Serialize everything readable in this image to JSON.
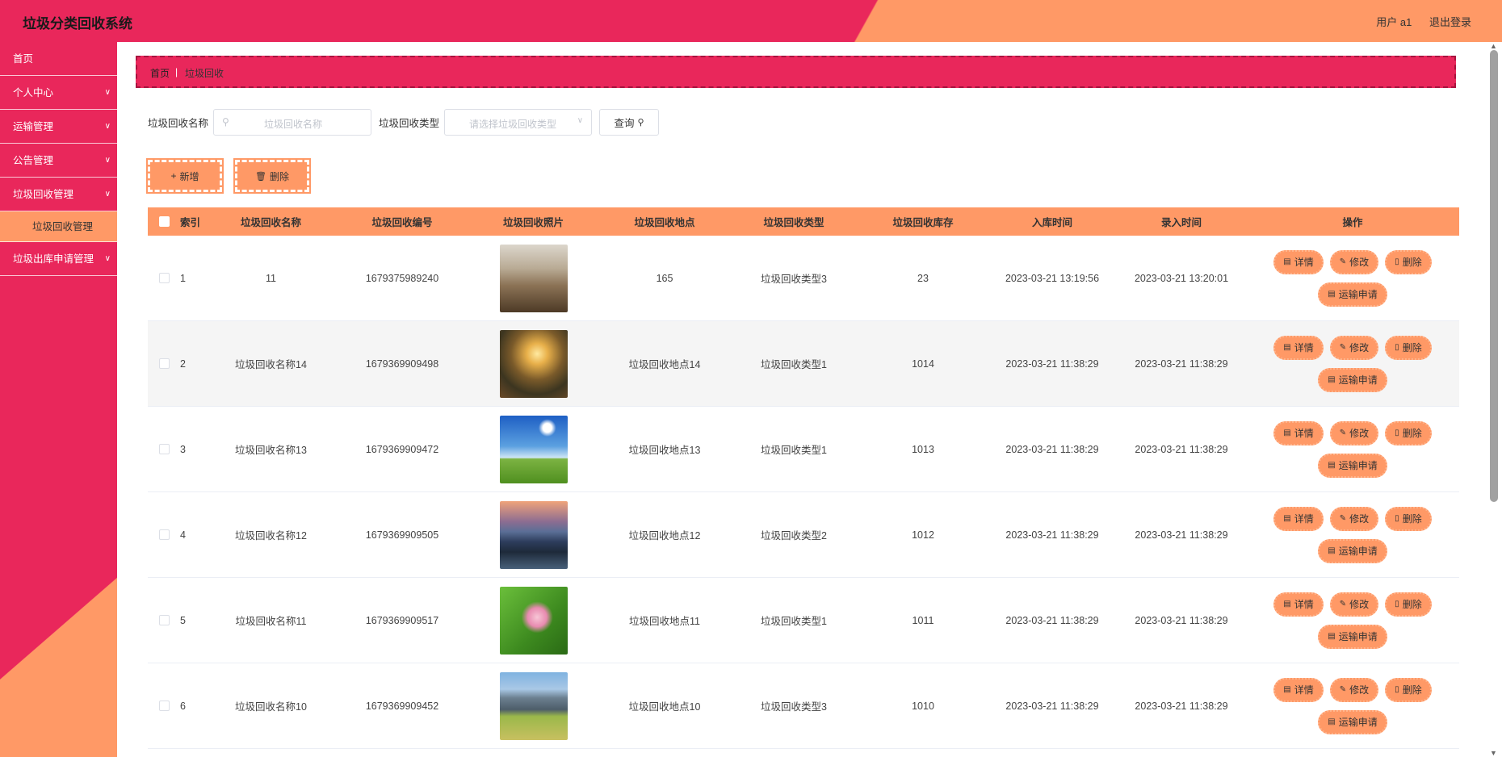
{
  "header": {
    "title": "垃圾分类回收系统",
    "user": "用户 a1",
    "logout": "退出登录"
  },
  "sidebar": {
    "items": [
      {
        "label": "首页",
        "has_children": false
      },
      {
        "label": "个人中心",
        "has_children": true
      },
      {
        "label": "运输管理",
        "has_children": true
      },
      {
        "label": "公告管理",
        "has_children": true
      },
      {
        "label": "垃圾回收管理",
        "has_children": true
      },
      {
        "label": "垃圾回收管理",
        "sub": true
      },
      {
        "label": "垃圾出库申请管理",
        "has_children": true
      }
    ]
  },
  "breadcrumb": {
    "home": "首页",
    "current": "垃圾回收"
  },
  "search": {
    "name_label": "垃圾回收名称",
    "name_placeholder": "垃圾回收名称",
    "type_label": "垃圾回收类型",
    "type_placeholder": "请选择垃圾回收类型",
    "query_label": "查询"
  },
  "actions": {
    "add": "新增",
    "delete": "删除"
  },
  "table": {
    "headers": [
      "索引",
      "垃圾回收名称",
      "垃圾回收编号",
      "垃圾回收照片",
      "垃圾回收地点",
      "垃圾回收类型",
      "垃圾回收库存",
      "入库时间",
      "录入时间",
      "操作"
    ],
    "op_labels": {
      "detail": "详情",
      "edit": "修改",
      "delete": "删除",
      "transport": "运输申请"
    },
    "rows": [
      {
        "index": "1",
        "name": "11",
        "code": "1679375989240",
        "photo": "waterfall",
        "location": "165",
        "type": "垃圾回收类型3",
        "stock": "23",
        "in_time": "2023-03-21 13:19:56",
        "record_time": "2023-03-21 13:20:01"
      },
      {
        "index": "2",
        "name": "垃圾回收名称14",
        "code": "1679369909498",
        "photo": "sunset-valley",
        "location": "垃圾回收地点14",
        "type": "垃圾回收类型1",
        "stock": "1014",
        "in_time": "2023-03-21 11:38:29",
        "record_time": "2023-03-21 11:38:29"
      },
      {
        "index": "3",
        "name": "垃圾回收名称13",
        "code": "1679369909472",
        "photo": "sky-meadow",
        "location": "垃圾回收地点13",
        "type": "垃圾回收类型1",
        "stock": "1013",
        "in_time": "2023-03-21 11:38:29",
        "record_time": "2023-03-21 11:38:29"
      },
      {
        "index": "4",
        "name": "垃圾回收名称12",
        "code": "1679369909505",
        "photo": "city-mountain",
        "location": "垃圾回收地点12",
        "type": "垃圾回收类型2",
        "stock": "1012",
        "in_time": "2023-03-21 11:38:29",
        "record_time": "2023-03-21 11:38:29"
      },
      {
        "index": "5",
        "name": "垃圾回收名称11",
        "code": "1679369909517",
        "photo": "lotus",
        "location": "垃圾回收地点11",
        "type": "垃圾回收类型1",
        "stock": "1011",
        "in_time": "2023-03-21 11:38:29",
        "record_time": "2023-03-21 11:38:29"
      },
      {
        "index": "6",
        "name": "垃圾回收名称10",
        "code": "1679369909452",
        "photo": "mountain-field",
        "location": "垃圾回收地点10",
        "type": "垃圾回收类型3",
        "stock": "1010",
        "in_time": "2023-03-21 11:38:29",
        "record_time": "2023-03-21 11:38:29"
      }
    ]
  },
  "colors": {
    "primary": "#e9275b",
    "accent": "#ff9966",
    "crumb_border": "#a8143f"
  }
}
